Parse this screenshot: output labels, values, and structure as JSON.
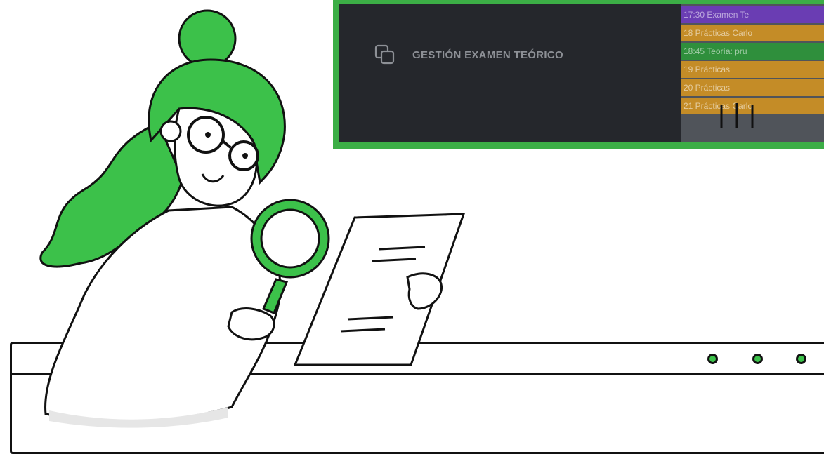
{
  "sidebar": {
    "item": {
      "label": "GESTIÓN EXAMEN TEÓRICO",
      "icon": "copy-icon"
    }
  },
  "calendar": {
    "events": [
      {
        "text": "17:30 Examen Te",
        "color": "#6a3db3"
      },
      {
        "text": "18 Prácticas Carlo",
        "color": "#c48c27"
      },
      {
        "text": "18:45 Teoría: pru",
        "color": "#2f8f3c"
      },
      {
        "text": "19 Prácticas",
        "color": "#c48c27"
      },
      {
        "text": "20 Prácticas",
        "color": "#c48c27"
      },
      {
        "text": "21 Prácticas Carlo",
        "color": "#c48c27"
      }
    ]
  },
  "window": {
    "dots": [
      "#3cc14a",
      "#3cc14a",
      "#3cc14a"
    ]
  },
  "illustration": {
    "subject": "woman-with-magnifying-glass"
  }
}
